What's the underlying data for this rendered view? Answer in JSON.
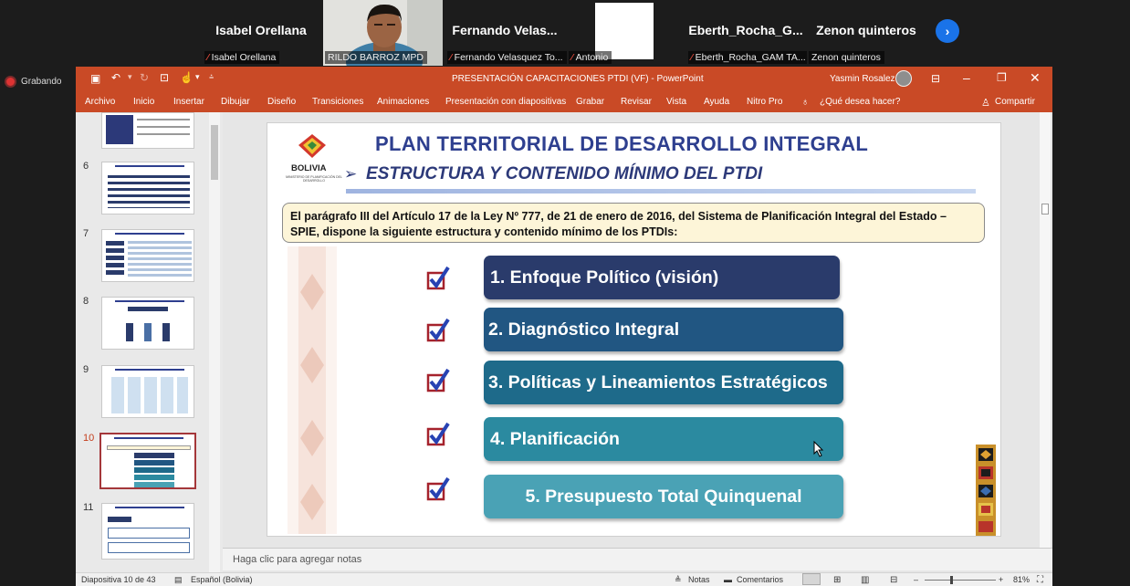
{
  "participants": [
    {
      "name": "Isabel Orellana",
      "label": "Isabel Orellana"
    },
    {
      "name": "",
      "label": "RILDO BARROZ MPD"
    },
    {
      "name": "Fernando  Velas...",
      "label": "Fernando Velasquez To..."
    },
    {
      "name": "",
      "label": "Antonio"
    },
    {
      "name": "Eberth_Rocha_G...",
      "label": "Eberth_Rocha_GAM TA..."
    },
    {
      "name": "Zenon quinteros",
      "label": "Zenon quinteros"
    }
  ],
  "recording": "Grabando",
  "ppt": {
    "title": "PRESENTACIÓN CAPACITACIONES PTDI (VF)  -  PowerPoint",
    "user": "Yasmin Rosalez",
    "tabs": [
      "Archivo",
      "Inicio",
      "Insertar",
      "Dibujar",
      "Diseño",
      "Transiciones",
      "Animaciones",
      "Presentación con diapositivas",
      "Grabar",
      "Revisar",
      "Vista",
      "Ayuda",
      "Nitro Pro"
    ],
    "search": "¿Qué desea hacer?",
    "share": "Compartir",
    "thumbnails": [
      "6",
      "7",
      "8",
      "9",
      "10",
      "11"
    ],
    "notes_placeholder": "Haga clic para agregar notas",
    "status": {
      "slide": "Diapositiva 10 de 43",
      "language": "Español (Bolivia)",
      "notes": "Notas",
      "comments": "Comentarios",
      "zoom": "81%"
    }
  },
  "slide": {
    "logo_text": "BOLIVIA",
    "logo_sub": "MINISTERIO DE PLANIFICACIÓN DEL DESARROLLO",
    "title": "PLAN TERRITORIAL DE DESARROLLO INTEGRAL",
    "subtitle": "ESTRUCTURA Y CONTENIDO MÍNIMO DEL PTDI",
    "intro": "El parágrafo III del Artículo 17 de la Ley Nº 777, de 21 de enero de 2016, del Sistema de Planificación Integral del Estado – SPIE, dispone la siguiente estructura y contenido mínimo de los PTDIs:",
    "items": [
      "1. Enfoque Político (visión)",
      "2. Diagnóstico Integral",
      "3. Políticas y Lineamientos Estratégicos",
      "4. Planificación",
      "5. Presupuesto Total Quinquenal"
    ]
  },
  "colors": {
    "ppt_accent": "#c94a26",
    "item1": "#2a3b6b",
    "item2": "#215682",
    "item3": "#1e6a8a",
    "item4": "#2b8aa0",
    "item5": "#4aa2b5",
    "title": "#2e3f8f"
  }
}
